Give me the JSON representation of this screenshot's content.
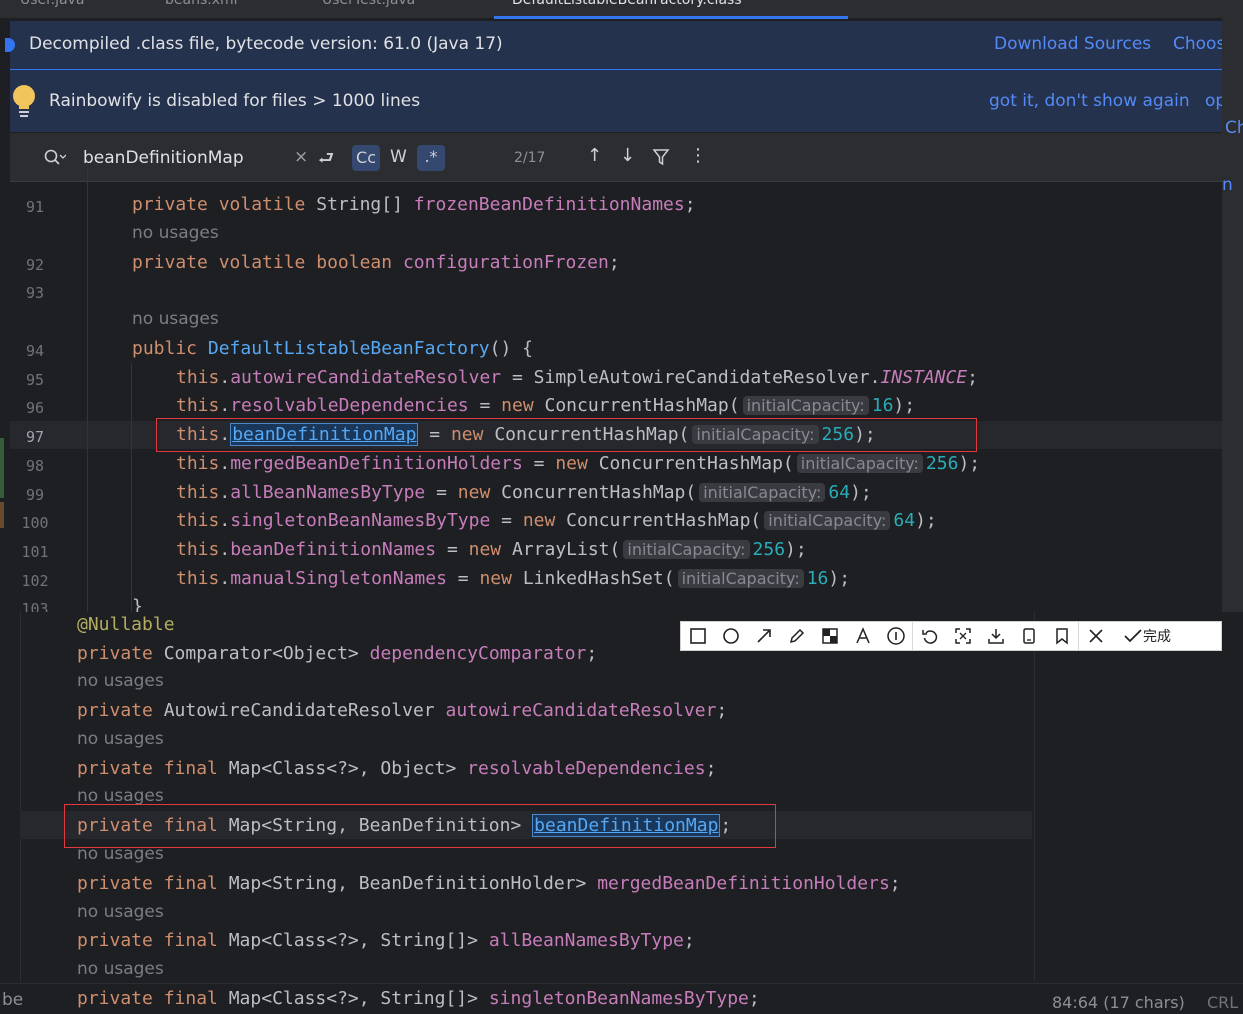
{
  "tabs": [
    {
      "label": "User.java"
    },
    {
      "label": "beans.xml"
    },
    {
      "label": "UserTest.java"
    },
    {
      "label": "DefaultListableBeanFactory.class"
    }
  ],
  "banner_decompiled": {
    "text": "Decompiled .class file, bytecode version: 61.0 (Java 17)",
    "download_sources": "Download Sources",
    "choose_sources": "Choos"
  },
  "banner_rainbowify": {
    "text": "Rainbowify is disabled for files > 1000 lines",
    "dismiss": "got it, don't show again",
    "more": "op"
  },
  "search": {
    "query": "beanDefinitionMap",
    "match_case": "Cc",
    "words": "W",
    "regex": ".*",
    "count": "2/17"
  },
  "right_edge": {
    "c1": "Ch",
    "c2": "n"
  },
  "top_code": {
    "lines": [
      {
        "n": "91"
      },
      {
        "n": "92"
      },
      {
        "n": "93"
      },
      {
        "n": "94"
      },
      {
        "n": "95"
      },
      {
        "n": "96"
      },
      {
        "n": "97"
      },
      {
        "n": "98"
      },
      {
        "n": "99"
      },
      {
        "n": "100"
      },
      {
        "n": "101"
      },
      {
        "n": "102"
      },
      {
        "n": "103"
      }
    ],
    "usage_label": "no usages",
    "hint_label": "initialCapacity:",
    "values": {
      "frozen": "frozenBeanDefinitionNames",
      "config": "configurationFrozen",
      "ctor": "DefaultListableBeanFactory",
      "autowire": "autowireCandidateResolver",
      "simple": "SimpleAutowireCandidateResolver",
      "instance": "INSTANCE",
      "resolvable": "resolvableDependencies",
      "chm": "ConcurrentHashMap",
      "bdm": "beanDefinitionMap",
      "merged": "mergedBeanDefinitionHolders",
      "allbn": "allBeanNamesByType",
      "single": "singletonBeanNamesByType",
      "bdn": "beanDefinitionNames",
      "arraylist": "ArrayList",
      "manual": "manualSingletonNames",
      "lhs": "LinkedHashSet",
      "v16": "16",
      "v256": "256",
      "v64": "64"
    }
  },
  "bottom_code": {
    "annotation": "@Nullable",
    "usage_label": "no usages",
    "comparator_type": "Comparator<Object>",
    "comparator_field": "dependencyComparator",
    "acr_type": "AutowireCandidateResolver",
    "acr_field": "autowireCandidateResolver",
    "rd_type": "Map<Class<?>, Object>",
    "rd_field": "resolvableDependencies",
    "bdm_type": "Map<String, BeanDefinition>",
    "bdm_field": "beanDefinitionMap",
    "mbdh_type": "Map<String, BeanDefinitionHolder>",
    "mbdh_field": "mergedBeanDefinitionHolders",
    "abnt_type": "Map<Class<?>, String[]>",
    "abnt_field": "allBeanNamesByType",
    "sbnt_type": "Map<Class<?>, String[]>",
    "sbnt_field": "singletonBeanNamesByType"
  },
  "snip_toolbar": {
    "tools": [
      "rectangle-icon",
      "ellipse-icon",
      "arrow-icon",
      "pen-icon",
      "mosaic-icon",
      "text-icon",
      "number-icon",
      "undo-icon",
      "pin-icon",
      "download-icon",
      "phone-icon",
      "bookmark-icon",
      "close-icon"
    ],
    "done": "完成"
  },
  "status": {
    "left": "be",
    "position": "84:64 (17 chars)",
    "line_ending": "CRL"
  }
}
